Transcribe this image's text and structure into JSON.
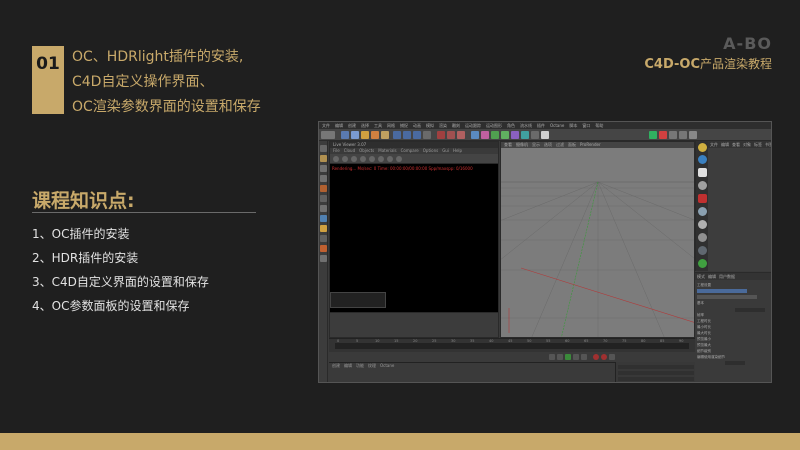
{
  "lesson": {
    "number": "01",
    "title_lines": [
      "OC、HDRlight插件的安装,",
      "C4D自定义操作界面、",
      "OC渲染参数界面的设置和保存"
    ]
  },
  "brand": {
    "name": "A-BO",
    "sub_bold": "C4D-OC",
    "sub_rest": "产品渲染教程"
  },
  "knowledge": {
    "title": "课程知识点:",
    "items": [
      "1、OC插件的安装",
      "2、HDR插件的安装",
      "3、C4D自定义界面的设置和保存",
      "4、OC参数面板的设置和保存"
    ]
  },
  "colors": {
    "background": "#1f1f1f",
    "accent_gold": "#c8a96a",
    "brand_gray": "#5a5a5a"
  },
  "c4d": {
    "menubar": [
      "文件",
      "编辑",
      "创建",
      "选择",
      "工具",
      "网格",
      "捕捉",
      "动画",
      "模拟",
      "渲染",
      "雕刻",
      "运动跟踪",
      "运动图形",
      "角色",
      "流水线",
      "插件",
      "Octane",
      "脚本",
      "窗口",
      "帮助"
    ],
    "liveviewer": {
      "title": "Live Viewer 3.07",
      "menu": [
        "File",
        "Cloud",
        "Objects",
        "Materials",
        "Compare",
        "Options",
        "Gui",
        "Help"
      ],
      "status": "Rendering... Ms/sec: 0  Time: 00:00:00/00:00:00  Spp/maxspp: 0/16000"
    },
    "viewport_menu": [
      "查看",
      "摄像机",
      "显示",
      "选项",
      "过滤",
      "面板",
      "ProRender"
    ],
    "object_menu": [
      "文件",
      "编辑",
      "查看",
      "对象",
      "标签",
      "书签"
    ],
    "attribute_tabs": [
      "模式",
      "编辑",
      "用户数据"
    ],
    "attribute_labels": [
      "工程设置",
      "基本",
      "帧率",
      "工程时长",
      "最小时长",
      "最大时长",
      "预览最小",
      "预览最大",
      "细节级别",
      "编辑使用渲染细节"
    ],
    "timeline_ticks": [
      "0",
      "5",
      "10",
      "15",
      "20",
      "25",
      "30",
      "35",
      "40",
      "45",
      "50",
      "55",
      "60",
      "65",
      "70",
      "75",
      "80",
      "85",
      "90"
    ],
    "material_menu": [
      "创建",
      "编辑",
      "功能",
      "纹理",
      "Octane"
    ]
  }
}
